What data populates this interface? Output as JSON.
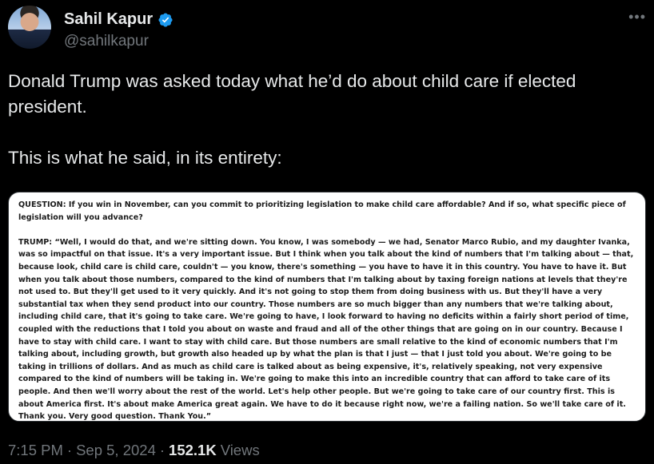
{
  "author": {
    "display_name": "Sahil Kapur",
    "handle": "@sahilkapur",
    "verified_icon": "verified-badge-icon",
    "verified_color": "#1d9bf0"
  },
  "menu_icon": "more-horizontal-icon",
  "tweet": {
    "paragraphs": [
      "Donald Trump was asked today what he’d do about child care if elected president.",
      "This is what he said, in its entirety:"
    ]
  },
  "transcript": {
    "question": "QUESTION: If you win in November, can you commit to prioritizing legislation to make child care affordable? And if so, what specific piece of legislation will you advance?",
    "answer": "TRUMP: “Well, I would do that, and we're sitting down. You know, I was somebody — we had, Senator Marco Rubio, and my daughter Ivanka, was so impactful on that issue. It's a very important issue. But I think when you talk about the kind of numbers that I'm talking about — that, because look, child care is child care, couldn't — you know, there's something — you have to have it in this country. You have to have it. But when you talk about those numbers, compared to the kind of numbers that I'm talking about by taxing foreign nations at levels that they're not used to. But they'll get used to it very quickly. And it's not going to stop them from doing business with us. But they'll have a very substantial tax when they send product into our country. Those numbers are so much bigger than any numbers that we're talking about, including child care, that it's going to take care. We're going to have, I look forward to having no deficits within a fairly short period of time, coupled with the reductions that I told you about on waste and fraud and all of the other things that are going on in our country. Because I have to stay with child care. I want to stay with child care. But those numbers are small relative to the kind of economic numbers that I'm talking about, including growth, but growth also headed up by what the plan is that I just — that I just told you about. We're going to be taking in trillions of dollars. And as much as child care is talked about as being expensive, it's, relatively speaking, not very expensive compared to the kind of numbers will be taking in. We're going to make this into an incredible country that can afford to take care of its people. And then we'll worry about the rest of the world. Let's help other people. But we're going to take care of our country first. This is about America first. It's about make America great again. We have to do it because right now, we're a failing nation. So we'll take care of it. Thank you. Very good question. Thank You.”"
  },
  "footer": {
    "time": "7:15 PM",
    "sep1": "·",
    "date": "Sep 5, 2024",
    "sep2": "·",
    "views_count": "152.1K",
    "views_label": "Views"
  },
  "colors": {
    "background": "#000000",
    "primary_text": "#e7e9ea",
    "secondary_text": "#71767b"
  }
}
